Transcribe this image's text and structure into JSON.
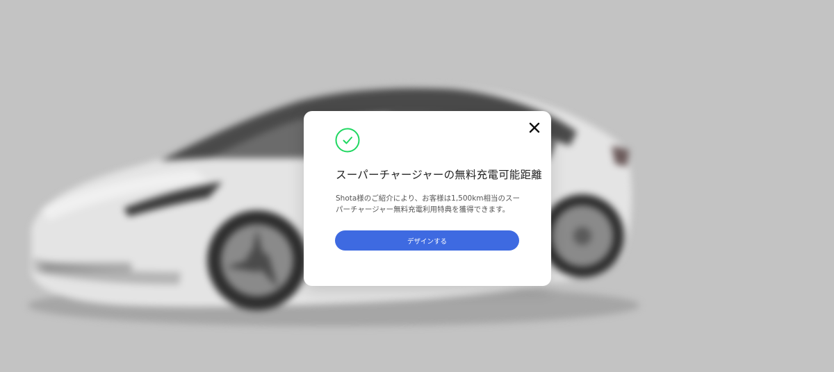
{
  "background": {
    "image": "tesla-model-3-white-car"
  },
  "modal": {
    "icon": "check-circle-icon",
    "accent_color": "#1ed760",
    "title": "スーパーチャージャーの無料充電可能距離",
    "description": "Shota様のご紹介により、お客様は1,500km相当のスーパーチャージャー無料充電利用特典を獲得できます。",
    "cta_label": "デザインする",
    "cta_color": "#3e6ae1",
    "close_icon": "close-icon"
  }
}
